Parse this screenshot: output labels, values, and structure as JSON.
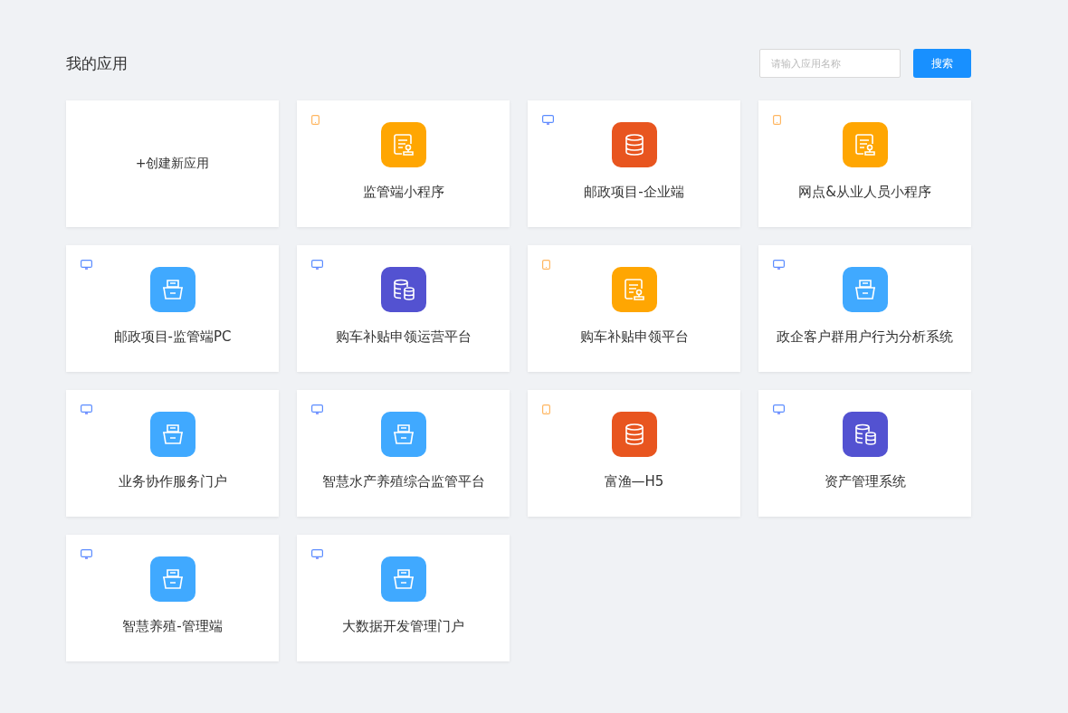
{
  "title": "我的应用",
  "search": {
    "placeholder": "请输入应用名称",
    "button": "搜索"
  },
  "create_card": {
    "label": "+创建新应用"
  },
  "apps": [
    {
      "name": "监管端小程序",
      "platform": {
        "kind": "mobile"
      },
      "icon": {
        "kind": "document"
      }
    },
    {
      "name": "邮政项目-企业端",
      "platform": {
        "kind": "pc"
      },
      "icon": {
        "kind": "database"
      }
    },
    {
      "name": "网点&从业人员小程序",
      "platform": {
        "kind": "mobile"
      },
      "icon": {
        "kind": "document"
      }
    },
    {
      "name": "邮政项目-监管端PC",
      "platform": {
        "kind": "pc"
      },
      "icon": {
        "kind": "cabinet"
      }
    },
    {
      "name": "购车补贴申领运营平台",
      "platform": {
        "kind": "pc"
      },
      "icon": {
        "kind": "databases"
      }
    },
    {
      "name": "购车补贴申领平台",
      "platform": {
        "kind": "mobile"
      },
      "icon": {
        "kind": "document"
      }
    },
    {
      "name": "政企客户群用户行为分析系统",
      "platform": {
        "kind": "pc"
      },
      "icon": {
        "kind": "cabinet"
      }
    },
    {
      "name": "业务协作服务门户",
      "platform": {
        "kind": "pc"
      },
      "icon": {
        "kind": "cabinet"
      }
    },
    {
      "name": "智慧水产养殖综合监管平台",
      "platform": {
        "kind": "pc"
      },
      "icon": {
        "kind": "cabinet"
      }
    },
    {
      "name": "富渔—H5",
      "platform": {
        "kind": "mobile"
      },
      "icon": {
        "kind": "database"
      }
    },
    {
      "name": "资产管理系统",
      "platform": {
        "kind": "pc"
      },
      "icon": {
        "kind": "databases"
      }
    },
    {
      "name": "智慧养殖-管理端",
      "platform": {
        "kind": "pc"
      },
      "icon": {
        "kind": "cabinet"
      }
    },
    {
      "name": "大数据开发管理门户",
      "platform": {
        "kind": "pc"
      },
      "icon": {
        "kind": "cabinet"
      }
    }
  ]
}
